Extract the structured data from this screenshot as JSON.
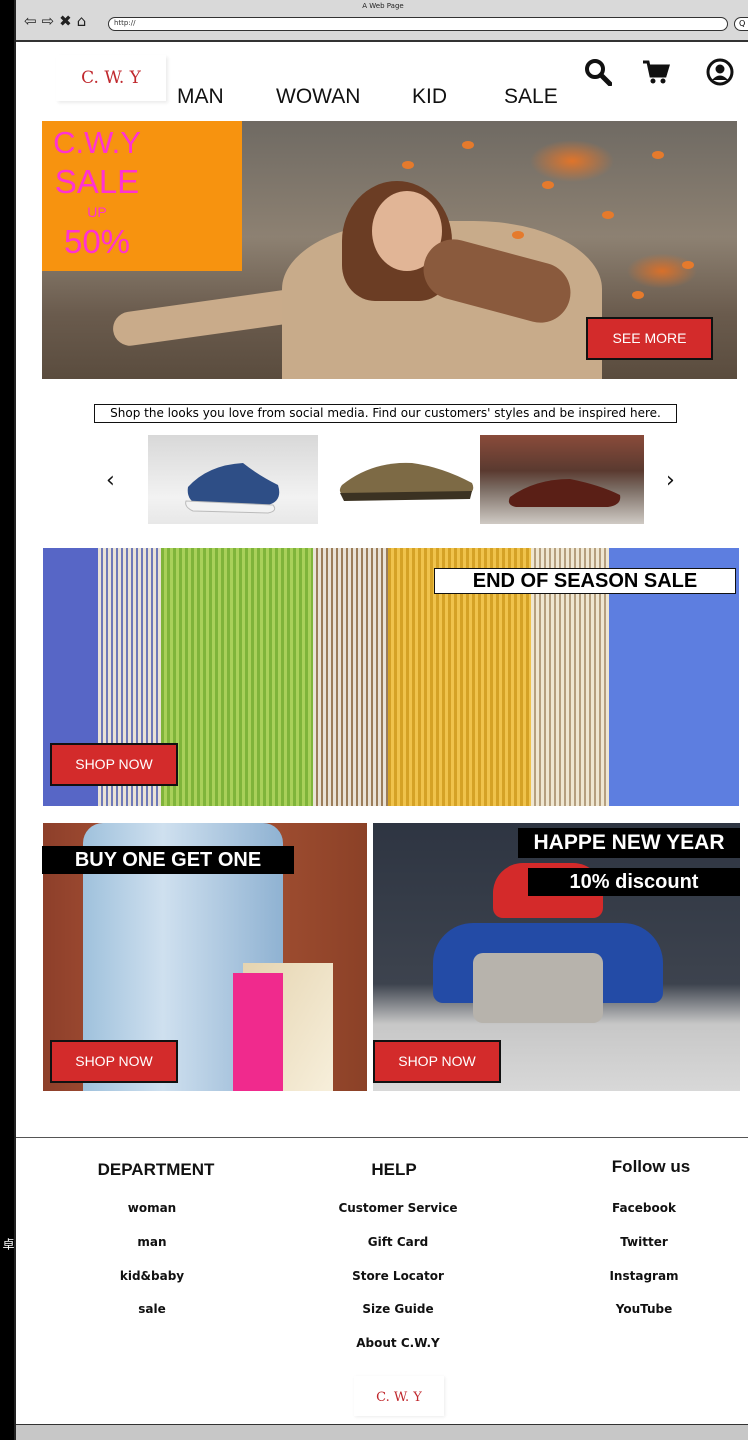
{
  "browser": {
    "title": "A Web Page",
    "url": "http://",
    "nav_icons": [
      "back-icon",
      "forward-icon",
      "close-icon",
      "home-icon"
    ],
    "search_glyph": "Q"
  },
  "header": {
    "logo": "C. W. Y",
    "nav": [
      "MAN",
      "WOWAN",
      "KID",
      "SALE"
    ],
    "icons": [
      "search-icon",
      "cart-icon",
      "account-icon"
    ]
  },
  "hero": {
    "line1": "C.W.Y",
    "line2": "SALE",
    "line3": "UP",
    "line4": "50%",
    "button": "SEE MORE"
  },
  "social": {
    "caption": "Shop the looks you love from social media. Find our customers' styles and be inspired here.",
    "prev": "‹",
    "next": "›"
  },
  "banners": {
    "end_of_season": "END OF SEASON SALE",
    "bogo": "BUY ONE GET ONE",
    "new_year": "HAPPE NEW YEAR",
    "discount": "10% discount",
    "shop_now": "SHOP NOW"
  },
  "footer": {
    "department": {
      "title": "DEPARTMENT",
      "links": [
        "woman",
        "man",
        "kid&baby",
        "sale"
      ]
    },
    "help": {
      "title": "HELP",
      "links": [
        "Customer Service",
        "Gift Card",
        "Store Locator",
        "Size Guide",
        "About C.W.Y"
      ]
    },
    "follow": {
      "title": "Follow us",
      "links": [
        "Facebook",
        "Twitter",
        "Instagram",
        "YouTube"
      ]
    },
    "logo": "C. W. Y"
  },
  "colors": {
    "brand_red": "#d32b2b",
    "sale_orange": "#f7930f",
    "sale_magenta": "#ff32d2"
  },
  "side_glyph": "卓"
}
